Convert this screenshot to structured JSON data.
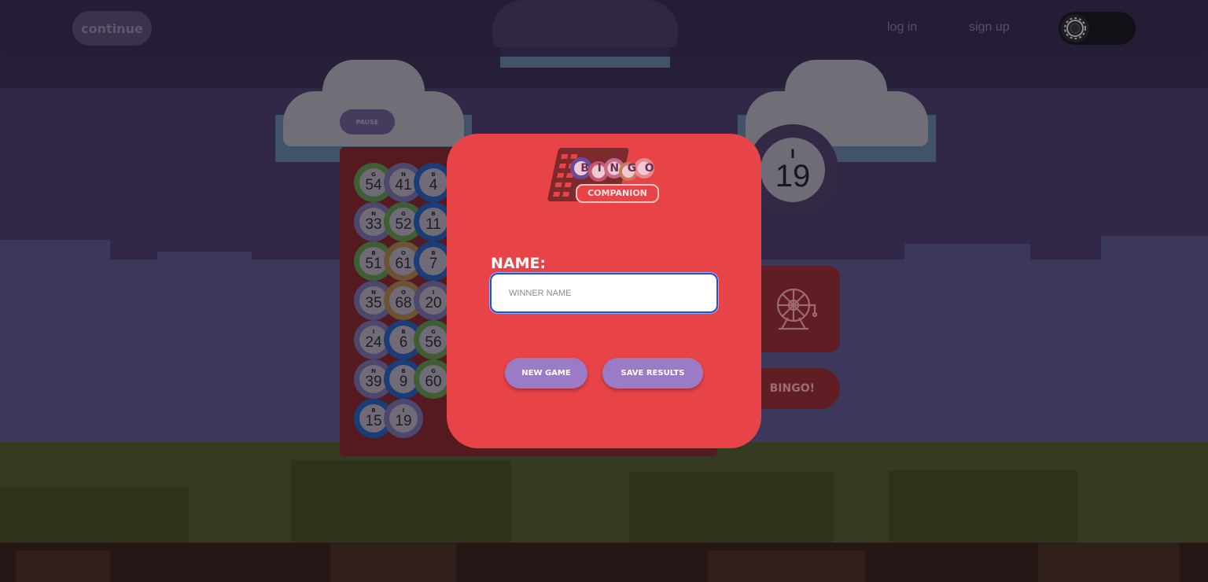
{
  "header": {
    "continue_label": "continue",
    "login_label": "log in",
    "signup_label": "sign up",
    "theme_toggle_icon": "gear-icon"
  },
  "game": {
    "pause_label": "PAUSE",
    "called_balls": [
      {
        "letter": "G",
        "number": "54",
        "color": "#4d7a3a"
      },
      {
        "letter": "N",
        "number": "41",
        "color": "#5f5a86"
      },
      {
        "letter": "B",
        "number": "4",
        "color": "#1d4c96"
      },
      {
        "letter": "N",
        "number": "33",
        "color": "#5f5a86"
      },
      {
        "letter": "G",
        "number": "52",
        "color": "#4d7a3a"
      },
      {
        "letter": "B",
        "number": "11",
        "color": "#1d4c96"
      },
      {
        "letter": "B",
        "number": "51",
        "color": "#4d7a3a"
      },
      {
        "letter": "O",
        "number": "61",
        "color": "#8a6a3a"
      },
      {
        "letter": "B",
        "number": "7",
        "color": "#1d4c96"
      },
      {
        "letter": "N",
        "number": "35",
        "color": "#5f5a86"
      },
      {
        "letter": "O",
        "number": "68",
        "color": "#8a6a3a"
      },
      {
        "letter": "I",
        "number": "20",
        "color": "#5f5a86"
      },
      {
        "letter": "I",
        "number": "24",
        "color": "#5f5a86"
      },
      {
        "letter": "B",
        "number": "6",
        "color": "#1d4c96"
      },
      {
        "letter": "G",
        "number": "56",
        "color": "#4d7a3a"
      },
      {
        "letter": "N",
        "number": "39",
        "color": "#5f5a86"
      },
      {
        "letter": "B",
        "number": "9",
        "color": "#1d4c96"
      },
      {
        "letter": "G",
        "number": "60",
        "color": "#4d7a3a"
      },
      {
        "letter": "B",
        "number": "15",
        "color": "#1d4c96"
      },
      {
        "letter": "I",
        "number": "19",
        "color": "#5f5a86"
      }
    ],
    "current_ball": {
      "letter": "I",
      "number": "19"
    },
    "spin_icon": "bingo-cage-icon",
    "bingo_label": "BINGO!"
  },
  "modal": {
    "logo_letters": [
      "B",
      "I",
      "N",
      "G",
      "O"
    ],
    "logo_subtitle": "COMPANION",
    "name_label": "NAME:",
    "name_placeholder": "WINNER NAME",
    "name_value": "",
    "new_game_label": "NEW GAME",
    "save_results_label": "SAVE RESULTS",
    "colors": {
      "modal_bg": "#e84347",
      "button_bg": "#9b7bc6",
      "input_border": "#2d4fb8"
    }
  }
}
